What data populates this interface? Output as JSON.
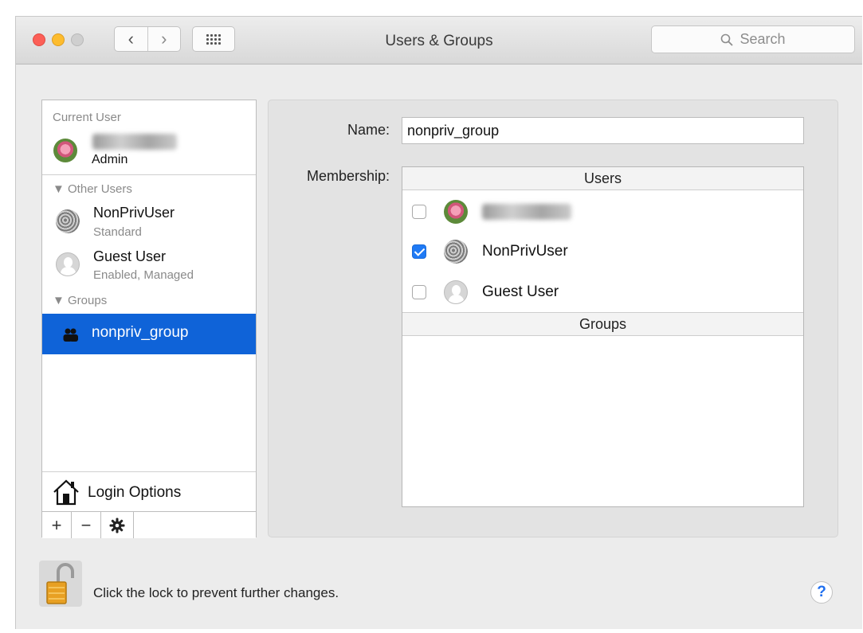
{
  "window": {
    "title": "Users & Groups"
  },
  "toolbar": {
    "search_placeholder": "Search"
  },
  "sidebar": {
    "current_user_header": "Current User",
    "current_user_role": "Admin",
    "other_users_header": "Other Users",
    "other_users": [
      {
        "name": "NonPrivUser",
        "type": "Standard"
      },
      {
        "name": "Guest User",
        "type": "Enabled, Managed"
      }
    ],
    "groups_header": "Groups",
    "groups": [
      {
        "name": "nonpriv_group"
      }
    ],
    "login_options": "Login Options",
    "add_label": "+",
    "remove_label": "−"
  },
  "detail": {
    "name_label": "Name:",
    "name_value": "nonpriv_group",
    "membership_label": "Membership:",
    "users_header": "Users",
    "groups_header": "Groups",
    "members": [
      {
        "name": "",
        "checked": false
      },
      {
        "name": "NonPrivUser",
        "checked": true
      },
      {
        "name": "Guest User",
        "checked": false
      }
    ]
  },
  "footer": {
    "lock_text": "Click the lock to prevent further changes.",
    "help_label": "?"
  },
  "colors": {
    "selection": "#0f63d8",
    "checkbox_on": "#1f7af5",
    "close": "#fc5f57",
    "minimize": "#fdbc2e"
  }
}
